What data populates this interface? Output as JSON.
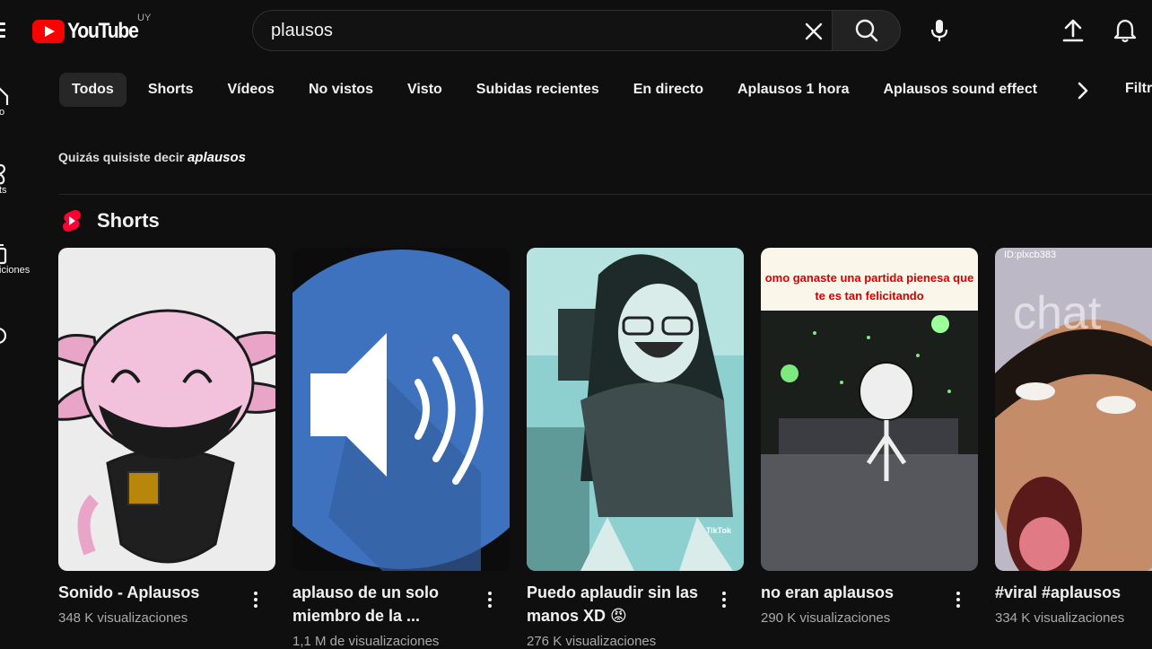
{
  "header": {
    "logo_text": "YouTube",
    "country": "UY",
    "search_value": "plausos",
    "search_placeholder": "Buscar"
  },
  "side_rail": {
    "items": [
      {
        "label": "o"
      },
      {
        "label": "ts"
      },
      {
        "label": "iciones"
      }
    ]
  },
  "chips": {
    "items": [
      "Todos",
      "Shorts",
      "Vídeos",
      "No vistos",
      "Visto",
      "Subidas recientes",
      "En directo",
      "Aplausos 1 hora",
      "Aplausos sound effect"
    ],
    "filters_label": "Filtr"
  },
  "did_you_mean": {
    "prefix": "Quizás quisiste decir ",
    "suggestion": "aplausos"
  },
  "shorts_section": {
    "title": "Shorts",
    "items": [
      {
        "title": "Sonido - Aplausos",
        "views": "348 K visualizaciones",
        "thumb_text": ""
      },
      {
        "title": "aplauso de un solo miembro de la ...",
        "views": "1,1 M de visualizaciones",
        "thumb_text": ""
      },
      {
        "title": "Puedo aplaudir sin las manos XD 😡",
        "views": "276 K visualizaciones",
        "thumb_text": "TikTok"
      },
      {
        "title": "no eran aplausos",
        "views": "290 K visualizaciones",
        "thumb_text": "omo ganaste una partida pienesa que te es tan felicitando"
      },
      {
        "title": "#viral #aplausos",
        "views": "334 K visualizaciones",
        "thumb_text": "ID:plxcb383"
      }
    ]
  },
  "colors": {
    "background": "#0f0f0f",
    "brand_red": "#ff0000",
    "chip_active": "#272727",
    "secondary_text": "#aaaaaa"
  }
}
